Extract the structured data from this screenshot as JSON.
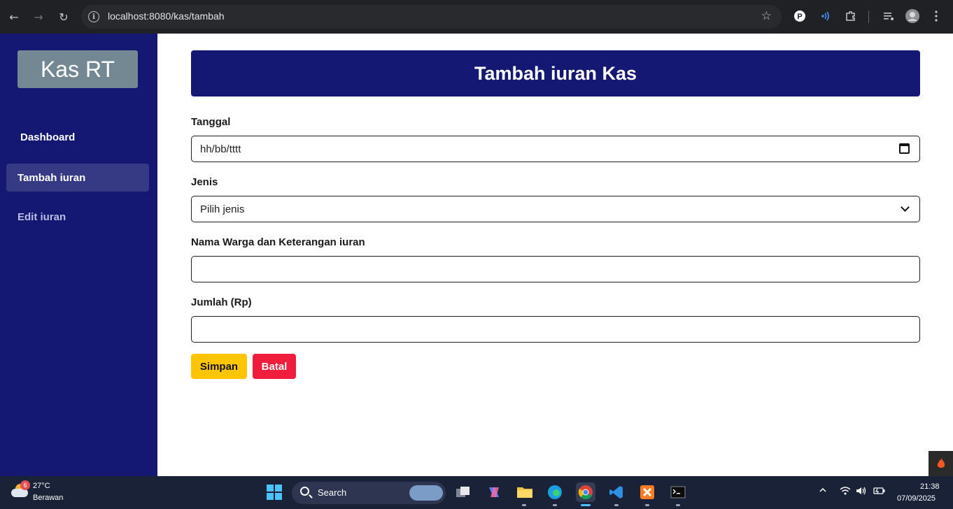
{
  "browser": {
    "url": "localhost:8080/kas/tambah",
    "back_icon": "←",
    "forward_icon": "→",
    "reload_icon": "↻",
    "info_icon": "i",
    "star_icon": "☆",
    "extensions": [
      "p-extension-icon",
      "radio-waves-icon",
      "puzzle-icon",
      "media-list-icon",
      "profile-avatar",
      "menu-dots-icon"
    ]
  },
  "sidebar": {
    "brand": "Kas RT",
    "items": [
      {
        "label": "Dashboard"
      },
      {
        "label": "Tambah iuran"
      },
      {
        "label": "Edit iuran"
      }
    ]
  },
  "main": {
    "title": "Tambah iuran Kas",
    "fields": {
      "date": {
        "label": "Tanggal",
        "placeholder": "hh/bb/tttt"
      },
      "type": {
        "label": "Jenis",
        "selected": "Pilih jenis"
      },
      "name": {
        "label": "Nama Warga dan Keterangan iuran",
        "value": ""
      },
      "amount": {
        "label": "Jumlah (Rp)",
        "value": ""
      }
    },
    "buttons": {
      "save": "Simpan",
      "cancel": "Batal"
    }
  },
  "taskbar": {
    "weather": {
      "badge": "6",
      "temp": "27°C",
      "condition": "Berawan"
    },
    "search_label": "Search",
    "clock": {
      "time": "21:38",
      "date": "07/09/2025"
    }
  },
  "colors": {
    "sidebar_bg": "#151873",
    "header_bg": "#151873",
    "save_btn": "#ffc600",
    "cancel_btn": "#ee1e3c",
    "brand_box": "#738892"
  }
}
